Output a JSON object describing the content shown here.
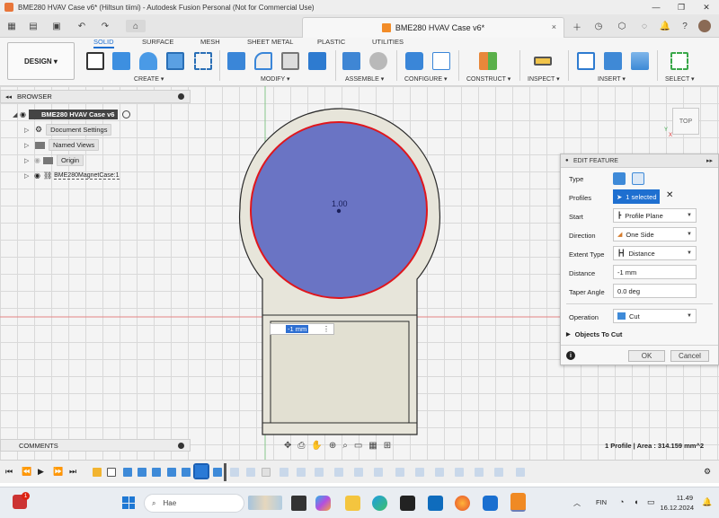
{
  "window": {
    "title": "BME280 HVAV Case v6* (Hiltsun tiimi) - Autodesk Fusion Personal (Not for Commercial Use)",
    "minimize_glyph": "—",
    "restore_glyph": "❐",
    "close_glyph": "✕"
  },
  "document_tab": {
    "label": "BME280 HVAV Case v6*",
    "close_glyph": "×"
  },
  "workspace": {
    "design_label": "DESIGN",
    "tabs": [
      "SOLID",
      "SURFACE",
      "MESH",
      "SHEET METAL",
      "PLASTIC",
      "UTILITIES"
    ],
    "active_tab": "SOLID",
    "groups": [
      "CREATE",
      "MODIFY",
      "ASSEMBLE",
      "CONFIGURE",
      "CONSTRUCT",
      "INSPECT",
      "INSERT",
      "SELECT"
    ]
  },
  "browser": {
    "title": "BROWSER",
    "root": "BME280 HVAV Case v6",
    "items": [
      "Document Settings",
      "Named Views",
      "Origin",
      "BME280MagnetCase:1"
    ]
  },
  "viewcube": {
    "label": "TOP"
  },
  "viewport": {
    "dimension_label": "1.00",
    "inline_input_value": "-1 mm",
    "inline_menu_glyph": "⋮"
  },
  "edit_feature": {
    "title": "EDIT FEATURE",
    "labels": {
      "type": "Type",
      "profiles": "Profiles",
      "start": "Start",
      "direction": "Direction",
      "extent_type": "Extent Type",
      "distance": "Distance",
      "taper_angle": "Taper Angle",
      "operation": "Operation"
    },
    "profiles_value": "1 selected",
    "start_value": "Profile Plane",
    "direction_value": "One Side",
    "extent_type_value": "Distance",
    "distance_value": "-1 mm",
    "taper_angle_value": "0.0 deg",
    "operation_value": "Cut",
    "objects_to_cut": "Objects To Cut",
    "ok_label": "OK",
    "cancel_label": "Cancel"
  },
  "comments": {
    "label": "COMMENTS"
  },
  "status": {
    "text": "1 Profile | Area : 314.159 mm^2"
  },
  "taskbar": {
    "search_placeholder": "Hae",
    "language": "FIN",
    "time": "11.49",
    "date": "16.12.2024",
    "notification_count": "1"
  },
  "colors": {
    "profile_fill": "#6a74c4",
    "profile_edge": "#e0161c",
    "body": "#e7e5da",
    "accent": "#1e6fd0"
  }
}
